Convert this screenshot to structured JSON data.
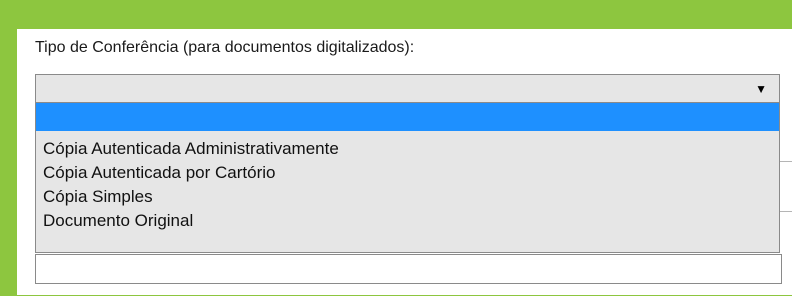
{
  "form": {
    "label": "Tipo de Conferência (para documentos digitalizados):",
    "select": {
      "selected_value": "",
      "arrow_icon": "triangle-down-icon",
      "options": [
        "",
        "Cópia Autenticada Administrativamente",
        "Cópia Autenticada por Cartório",
        "Cópia Simples",
        "Documento Original"
      ]
    }
  },
  "colors": {
    "frame_border": "#8dc63f",
    "highlight": "#1e90ff",
    "dropdown_background": "#e6e6e6"
  }
}
